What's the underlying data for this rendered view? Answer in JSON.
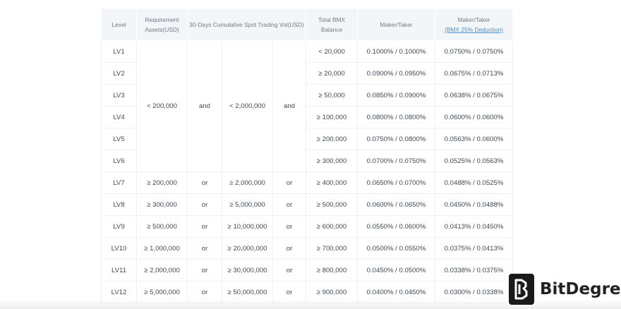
{
  "table": {
    "headers": {
      "level": "Level",
      "requirement": "Requirement Assets(USD)",
      "spot_vol": "30-Days Cumulative Spot Trading Vol(USD)",
      "bmx_balance": "Total BMX Balance",
      "maker_taker": "Maker/Taker",
      "bmx_main": "Maker/Taker",
      "bmx_sub": "(BMX 25% Deduction)"
    },
    "merged": {
      "assets": "< 200,000",
      "and1": "and",
      "vol": "< 2,000,000",
      "and2": "and"
    },
    "rows": [
      {
        "level": "LV1",
        "assets": "",
        "op1": "",
        "vol": "",
        "op2": "",
        "bmx": "< 20,000",
        "fee": "0.1000% / 0.1000%",
        "fee_bmx": "0.0750% / 0.0750%"
      },
      {
        "level": "LV2",
        "assets": "",
        "op1": "",
        "vol": "",
        "op2": "",
        "bmx": "≥ 20,000",
        "fee": "0.0900% / 0.0950%",
        "fee_bmx": "0.0675% / 0.0713%"
      },
      {
        "level": "LV3",
        "assets": "",
        "op1": "",
        "vol": "",
        "op2": "",
        "bmx": "≥ 50,000",
        "fee": "0.0850% / 0.0900%",
        "fee_bmx": "0.0638% / 0.0675%"
      },
      {
        "level": "LV4",
        "assets": "",
        "op1": "",
        "vol": "",
        "op2": "",
        "bmx": "≥ 100,000",
        "fee": "0.0800% / 0.0800%",
        "fee_bmx": "0.0600% / 0.0600%"
      },
      {
        "level": "LV5",
        "assets": "",
        "op1": "",
        "vol": "",
        "op2": "",
        "bmx": "≥ 200,000",
        "fee": "0.0750% / 0.0800%",
        "fee_bmx": "0.0563% / 0.0600%"
      },
      {
        "level": "LV6",
        "assets": "",
        "op1": "",
        "vol": "",
        "op2": "",
        "bmx": "≥ 300,000",
        "fee": "0.0700% / 0.0750%",
        "fee_bmx": "0.0525% / 0.0563%"
      },
      {
        "level": "LV7",
        "assets": "≥ 200,000",
        "op1": "or",
        "vol": "≥ 2,000,000",
        "op2": "or",
        "bmx": "≥ 400,000",
        "fee": "0.0650% / 0.0700%",
        "fee_bmx": "0.0488% / 0.0525%"
      },
      {
        "level": "LV8",
        "assets": "≥ 300,000",
        "op1": "or",
        "vol": "≥ 5,000,000",
        "op2": "or",
        "bmx": "≥ 500,000",
        "fee": "0.0600% / 0.0650%",
        "fee_bmx": "0.0450% / 0.0488%"
      },
      {
        "level": "LV9",
        "assets": "≥ 500,000",
        "op1": "or",
        "vol": "≥ 10,000,000",
        "op2": "or",
        "bmx": "≥ 600,000",
        "fee": "0.0550% / 0.0600%",
        "fee_bmx": "0.0413% / 0.0450%"
      },
      {
        "level": "LV10",
        "assets": "≥ 1,000,000",
        "op1": "or",
        "vol": "≥ 20,000,000",
        "op2": "or",
        "bmx": "≥ 700,000",
        "fee": "0.0500% / 0.0550%",
        "fee_bmx": "0.0375% / 0.0413%"
      },
      {
        "level": "LV11",
        "assets": "≥ 2,000,000",
        "op1": "or",
        "vol": "≥ 30,000,000",
        "op2": "or",
        "bmx": "≥ 800,000",
        "fee": "0.0450% / 0.0500%",
        "fee_bmx": "0.0338% / 0.0375%"
      },
      {
        "level": "LV12",
        "assets": "≥ 5,000,000",
        "op1": "or",
        "vol": "≥ 50,000,000",
        "op2": "or",
        "bmx": "≥ 900,000",
        "fee": "0.0400% / 0.0450%",
        "fee_bmx": "0.0300% / 0.0338%"
      }
    ]
  },
  "watermark": {
    "brand": "BitDegree",
    "logo_icon": "bitdegree-logo-icon"
  },
  "colors": {
    "header_bg": "#f3f6f8",
    "link_blue": "#4b8fcc",
    "text": "#3e4953"
  }
}
